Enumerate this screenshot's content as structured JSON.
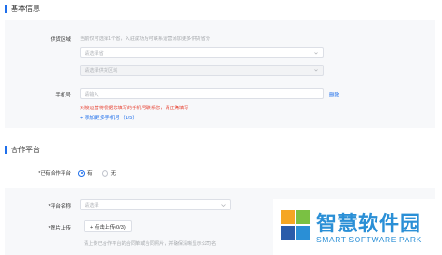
{
  "basic_section": {
    "title": "基本信息",
    "supply_area": {
      "label": "供货区域",
      "hint": "当前仅可选择1个省，入驻成功后可联系运营添加更多供货省份",
      "province_placeholder": "请选择省",
      "city_placeholder": "请选择供货区域"
    },
    "phone": {
      "label": "手机号",
      "placeholder": "请输入",
      "delete_label": "删除",
      "error_text": "对接运营将根据您填写的手机号联系您，请正确填写",
      "add_more_label": "+ 添加更多手机号（1/5）"
    }
  },
  "platform_section": {
    "title": "合作平台",
    "has_platform": {
      "label": "*已有合作平台",
      "options": [
        "有",
        "无"
      ],
      "selected": "有"
    },
    "platform_name": {
      "label": "*平台名称",
      "placeholder": "请选择"
    },
    "image_upload": {
      "label": "*图片上传",
      "button_label": "+  点击上传(0/3)",
      "hint": "请上传已合作平台的合同单或合同照片，并确保清晰显示公司名"
    }
  },
  "watermark": {
    "chinese": "智慧软件园",
    "english": "SMART SOFTWARE PARK"
  },
  "colors": {
    "accent": "#1f6feb",
    "error": "#e84c3d",
    "watermark_blue": "#2a8fd6",
    "watermark_orange": "#f5a623",
    "watermark_green": "#7ac143",
    "watermark_navy": "#2a5caa"
  }
}
